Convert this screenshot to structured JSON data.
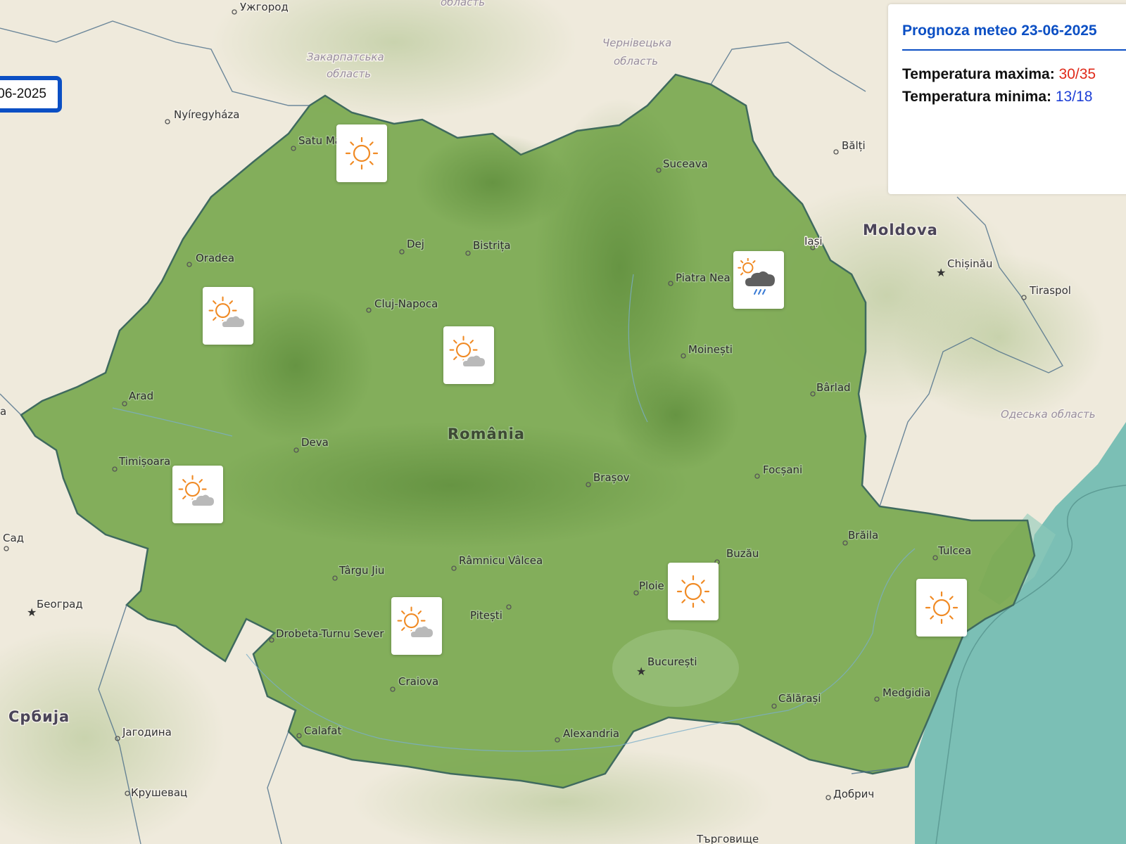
{
  "date_selector": {
    "label": "06-2025"
  },
  "info_panel": {
    "title": "Prognoza meteo 23-06-2025",
    "max_label": "Temperatura maxima:",
    "max_value": "30/35",
    "min_label": "Temperatura minima:",
    "min_value": "13/18"
  },
  "map": {
    "country_labels": {
      "romania": "România",
      "moldova": "Moldova",
      "serbia": "Србија"
    },
    "region_labels": {
      "zakarpattia_1": "Закарпатська",
      "zakarpattia_2": "область",
      "chernivtsi_1": "Чернівецька",
      "chernivtsi_2": "область",
      "odesa": "Одеська область",
      "top_oblast": "область"
    },
    "cities": {
      "uzhhorod": "Ужгород",
      "nyiregyhaza": "Nyíregyháza",
      "satu_mare": "Satu Ma",
      "suceava": "Suceava",
      "balti": "Bălți",
      "dej": "Dej",
      "bistrita": "Bistrița",
      "oradea": "Oradea",
      "iasi": "Iași",
      "chisinau": "Chișinău",
      "piatra_neamt": "Piatra Nea",
      "tiraspol": "Tiraspol",
      "cluj_napoca": "Cluj-Napoca",
      "moinesti": "Moinești",
      "barlad": "Bârlad",
      "arad": "Arad",
      "deva": "Deva",
      "timisoara": "Timișoara",
      "brasov": "Brașov",
      "focsani": "Focșani",
      "braila": "Brăila",
      "tulcea": "Tulcea",
      "sad": "Сад",
      "targu_jiu": "Târgu Jiu",
      "ramnicu_valcea": "Râmnicu Vâlcea",
      "buzau": "Buzău",
      "ploiesti": "Ploie",
      "beograd": "Београд",
      "pitesti": "Pitești",
      "drobeta": "Drobeta-Turnu Sever",
      "bucuresti": "București",
      "craiova": "Craiova",
      "medgidia": "Medgidia",
      "calarasi": "Călărași",
      "calafat": "Calafat",
      "jagodina": "Јагодина",
      "alexandria": "Alexandria",
      "krusevac": "Крушевац",
      "dobrich": "Добрич",
      "targovishte": "Търговище",
      "edge_a": "a"
    }
  },
  "weather_markers": [
    {
      "name": "satu-mare",
      "icon": "sun-icon"
    },
    {
      "name": "oradea",
      "icon": "sun-cloud-icon"
    },
    {
      "name": "cluj",
      "icon": "sun-cloud-icon"
    },
    {
      "name": "iasi",
      "icon": "sun-cloud-rain-icon"
    },
    {
      "name": "timisoara",
      "icon": "sun-cloud-icon"
    },
    {
      "name": "craiova",
      "icon": "sun-cloud-icon"
    },
    {
      "name": "bucuresti",
      "icon": "sun-icon"
    },
    {
      "name": "constanta",
      "icon": "sun-icon"
    }
  ],
  "colors": {
    "accent": "#0b4fc4",
    "max": "#e02a1a",
    "min": "#1d3fd6",
    "romania_fill": "#7aa84f",
    "sea": "#7bbfb5"
  }
}
